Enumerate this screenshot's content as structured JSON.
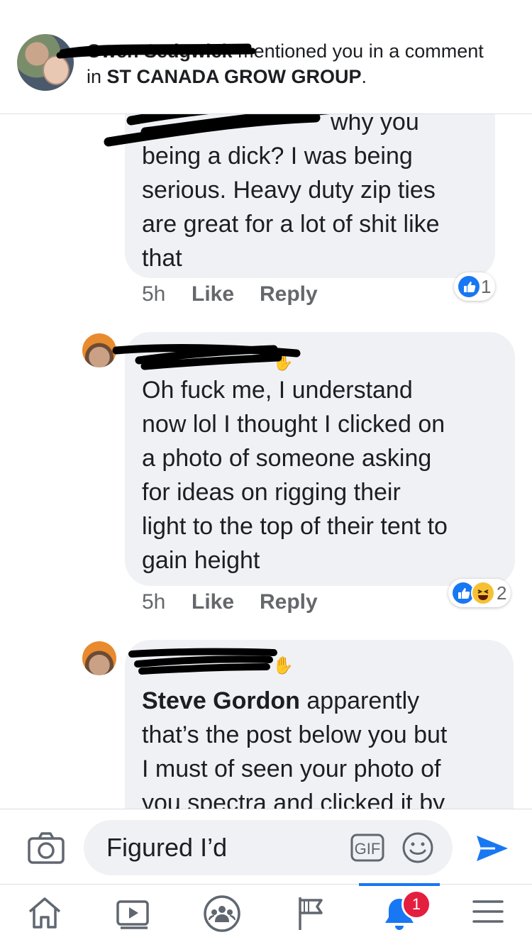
{
  "notification": {
    "actor_name": "Owen Sedgwick",
    "message": "mentioned you in a comment",
    "in_word": "in",
    "group": "ST CANADA  GROW GROUP",
    "period": "."
  },
  "comments": [
    {
      "author": "Steve Gordon",
      "text_lines": [
        "why you",
        "being a dick? I was being",
        "serious. Heavy duty zip ties",
        "are great for a lot of shit like",
        "that"
      ],
      "time": "5h",
      "like_label": "Like",
      "reply_label": "Reply",
      "reactions": {
        "icons": [
          "like-icon"
        ],
        "count": "1"
      }
    },
    {
      "author": "Josh",
      "text_lines": [
        "Oh fuck me, I understand",
        "now lol I thought I clicked on",
        "a photo of someone asking",
        "for ideas on rigging their",
        "light to the top of their tent to",
        "gain height"
      ],
      "time": "5h",
      "like_label": "Like",
      "reply_label": "Reply",
      "reactions": {
        "icons": [
          "like-icon",
          "haha-icon"
        ],
        "count": "2"
      }
    },
    {
      "author": "Josh",
      "mention": "Steve Gordon",
      "text_first": " apparently",
      "text_lines": [
        "that’s the post below you but",
        "I must of seen your photo of",
        "you spectra and clicked it by"
      ]
    }
  ],
  "composer": {
    "input_value": "Figured I’d",
    "gif_label": "GIF",
    "icons": [
      "camera-icon",
      "gif-icon",
      "emoji-icon",
      "send-icon"
    ]
  },
  "tabbar": {
    "tabs": [
      "home-icon",
      "watch-icon",
      "groups-icon",
      "pages-icon",
      "notifications-icon",
      "menu-icon"
    ],
    "active": "notifications-icon",
    "notification_badge": "1"
  },
  "colors": {
    "accent": "#1877f2",
    "bubble": "#f0f1f5",
    "badge": "#e41e3f",
    "meta_text": "#65676b",
    "haha": "#f7c034"
  }
}
